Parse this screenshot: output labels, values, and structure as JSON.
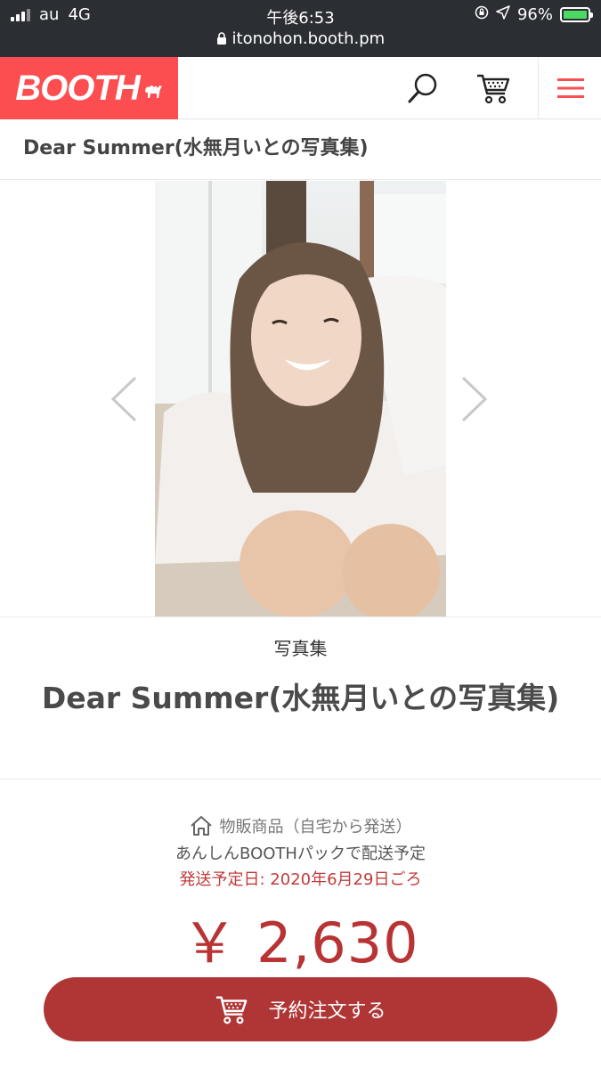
{
  "status_bar": {
    "carrier": "au",
    "network": "4G",
    "time": "午後6:53",
    "url": "itonohon.booth.pm",
    "battery": "96%"
  },
  "header": {
    "logo": "BOOTH",
    "brand_color": "#fc4d50"
  },
  "page_title": "Dear Summer(水無月いとの写真集)",
  "product": {
    "category": "写真集",
    "title": "Dear Summer(水無月いとの写真集)",
    "shipping_type": "物販商品（自宅から発送）",
    "shipping_pack": "あんしんBOOTHパックで配送予定",
    "ship_date": "発送予定日: 2020年6月29日ごろ",
    "price": "￥ 2,630",
    "order_button": "予約注文する"
  },
  "icons": [
    "search-icon",
    "cart-icon",
    "menu-icon",
    "chevron-left-icon",
    "chevron-right-icon",
    "home-icon"
  ],
  "colors": {
    "price": "#b83434",
    "button": "#b03535",
    "ship_date": "#c13b3b"
  }
}
